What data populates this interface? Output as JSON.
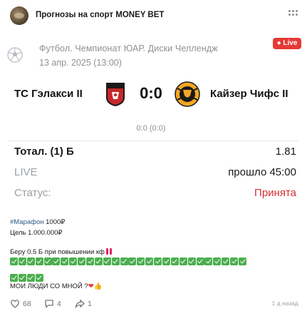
{
  "header": {
    "channel_name": "Прогнозы на спорт MONEY BET",
    "avatar_icon": "channel-avatar",
    "more_icon": "more-dots-icon"
  },
  "bet_card": {
    "league": "Футбол. Чемпионат ЮАР. Диски Челлендж",
    "date": "13 апр. 2025 (13:00)",
    "live_badge": "Live",
    "home_team": "TC Гэлакси II",
    "away_team": "Кайзер Чифс II",
    "score": "0:0",
    "halftime": "0:0 (0:0)",
    "bet_type_label": "Тотал. (1) Б",
    "odds": "1.81",
    "mode_label": "LIVE",
    "elapsed": "прошло 45:00",
    "status_label": "Статус:",
    "status_value": "Принята",
    "colors": {
      "live_badge": "#e53935",
      "accepted": "#d32f2f",
      "muted": "#9aa0a6"
    }
  },
  "post": {
    "hashtag": "#Марафон",
    "marathon_amount": " 1000₽",
    "goal_line": "Цель 1.000.000₽",
    "bet_line": "Беру 0.5 Б при повышении кф",
    "check_emoji_count": 32,
    "closing_line": "МОИ ЛЮДИ СО МНОЙ ?",
    "closing_emojis": [
      "heart",
      "thumbs-up"
    ]
  },
  "footer": {
    "likes": "68",
    "comments": "4",
    "shares": "1",
    "time": "1 д назад"
  }
}
